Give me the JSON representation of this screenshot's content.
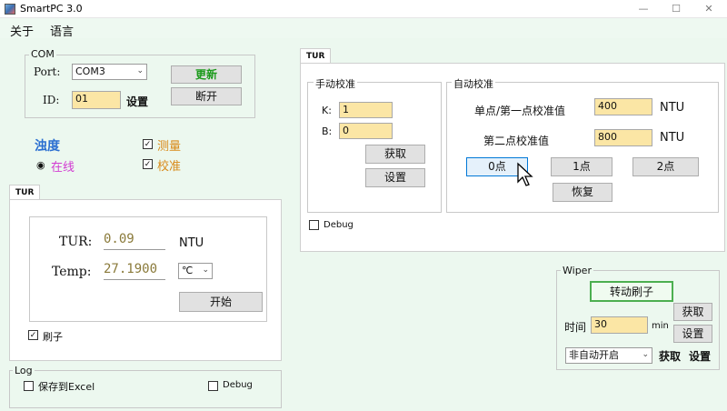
{
  "window": {
    "title": "SmartPC 3.0",
    "minimize": "—",
    "maximize": "☐",
    "close": "✕"
  },
  "menu": {
    "about": "关于",
    "language": "语言"
  },
  "com": {
    "group_label": "COM",
    "port_label": "Port:",
    "port_value": "COM3",
    "id_label": "ID:",
    "id_value": "01",
    "set_btn": "设置",
    "update_btn": "更新",
    "disconnect_btn": "断开"
  },
  "turbidity": {
    "title": "浊度",
    "online": "在线",
    "measure": "测量",
    "calibrate": "校准"
  },
  "tur_panel": {
    "tab": "TUR",
    "tur_label": "TUR:",
    "tur_value": "0.09",
    "tur_unit": "NTU",
    "temp_label": "Temp:",
    "temp_value": "27.1900",
    "temp_unit": "℃",
    "start_btn": "开始",
    "brush_label": "刷子"
  },
  "log": {
    "group_label": "Log",
    "save_excel": "保存到Excel",
    "debug": "Debug"
  },
  "cal_panel": {
    "tab": "TUR",
    "manual_label": "手动校准",
    "k_label": "K:",
    "k_value": "1",
    "b_label": "B:",
    "b_value": "0",
    "get_btn": "获取",
    "set_btn": "设置",
    "auto_label": "自动校准",
    "point1_label": "单点/第一点校准值",
    "point1_value": "400",
    "point1_unit": "NTU",
    "point2_label": "第二点校准值",
    "point2_value": "800",
    "point2_unit": "NTU",
    "zero_btn": "0点",
    "one_btn": "1点",
    "two_btn": "2点",
    "restore_btn": "恢复",
    "debug": "Debug"
  },
  "wiper": {
    "group_label": "Wiper",
    "rotate_btn": "转动刷子",
    "time_label": "时间",
    "time_value": "30",
    "time_unit": "min",
    "get_btn": "获取",
    "set_btn": "设置",
    "mode_value": "非自动开启",
    "get_btn2": "获取",
    "set_btn2": "设置"
  },
  "colors": {
    "background": "#ecf8ef",
    "input": "#fbe6a5",
    "accent_blue": "#2b6fd1",
    "online": "#d23bd2",
    "orange": "#d98a1a",
    "green": "#1a9a1a"
  }
}
